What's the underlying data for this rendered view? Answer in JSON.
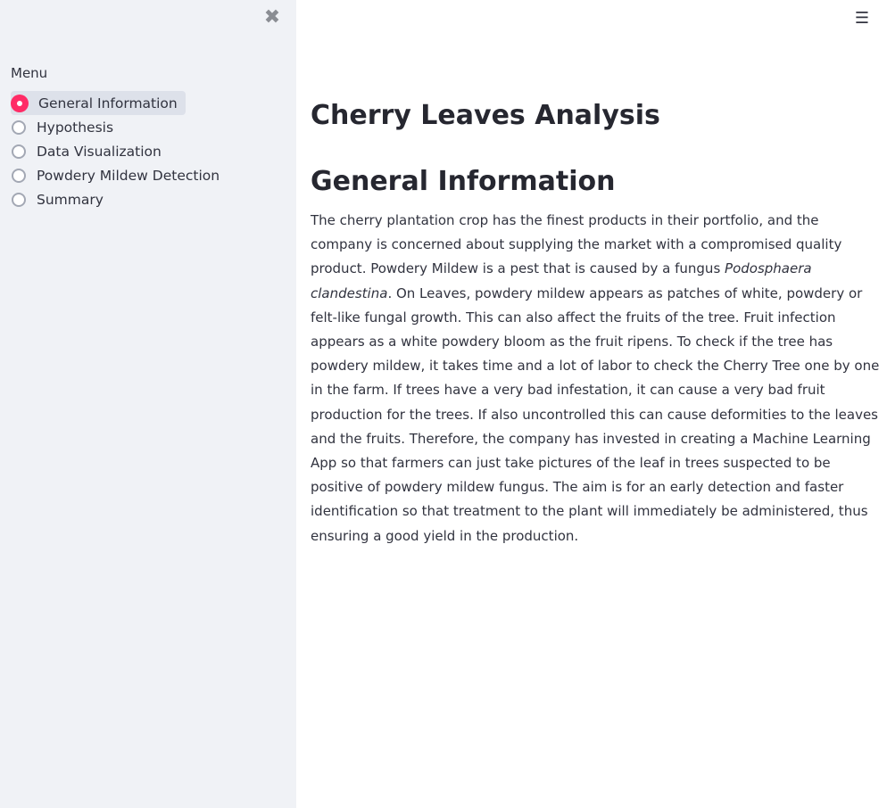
{
  "sidebar": {
    "close_glyph": "✖",
    "menu_label": "Menu",
    "items": [
      {
        "label": "General Information",
        "selected": true
      },
      {
        "label": "Hypothesis",
        "selected": false
      },
      {
        "label": "Data Visualization",
        "selected": false
      },
      {
        "label": "Powdery Mildew Detection",
        "selected": false
      },
      {
        "label": "Summary",
        "selected": false
      }
    ]
  },
  "header": {
    "menu_glyph": "☰"
  },
  "main": {
    "title": "Cherry Leaves Analysis",
    "section_heading": "General Information",
    "paragraph": {
      "part1": "The cherry plantation crop has the finest products in their portfolio, and the company is concerned about supplying the market with a compromised quality product. Powdery Mildew is a pest that is caused by a fungus ",
      "species": "Podosphaera clandestina",
      "part2": ". On Leaves, powdery mildew appears as patches of white, powdery or felt-like fungal growth. This can also affect the fruits of the tree. Fruit infection appears as a white powdery bloom as the fruit ripens. To check if the tree has powdery mildew, it takes time and a lot of labor to check the Cherry Tree one by one in the farm. If trees have a very bad infestation, it can cause a very bad fruit production for the trees. If also uncontrolled this can cause deformities to the leaves and the fruits. Therefore, the company has invested in creating a Machine Learning App so that farmers can just take pictures of the leaf in trees suspected to be positive of powdery mildew fungus. The aim is for an early detection and faster identification so that treatment to the plant will immediately be administered, thus ensuring a good yield in the production."
    }
  },
  "colors": {
    "sidebar_bg": "#f0f2f6",
    "accent": "#ff2b66",
    "text": "#31333f",
    "heading": "#262730"
  }
}
